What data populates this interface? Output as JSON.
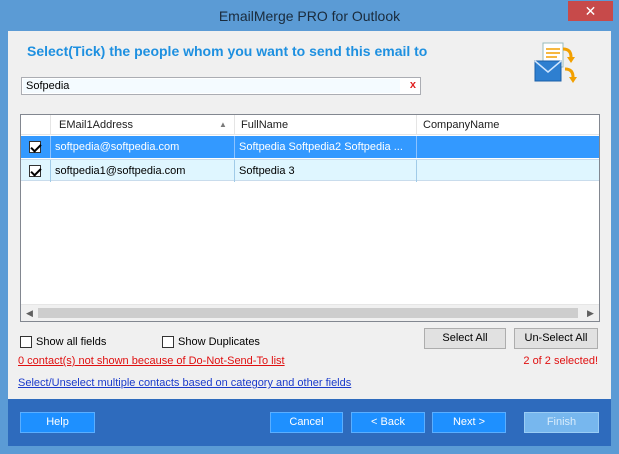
{
  "window": {
    "title": "EmailMerge PRO for Outlook",
    "close_label": "✕"
  },
  "header": {
    "instruction": "Select(Tick) the people whom you want to send this email to"
  },
  "search": {
    "value": "Sofpedia",
    "clear_label": "x"
  },
  "grid": {
    "columns": [
      "EMail1Address",
      "FullName",
      "CompanyName"
    ],
    "rows": [
      {
        "checked": true,
        "email": "softpedia@softpedia.com",
        "fullname": "Softpedia Softpedia2 Softpedia ...",
        "company": ""
      },
      {
        "checked": true,
        "email": "softpedia1@softpedia.com",
        "fullname": "Softpedia 3",
        "company": ""
      }
    ]
  },
  "options": {
    "show_all_fields": "Show all fields",
    "show_duplicates": "Show Duplicates",
    "select_all": "Select All",
    "unselect_all": "Un-Select All"
  },
  "status": {
    "dnst_link": "0 contact(s) not shown because of Do-Not-Send-To list",
    "selected_count": "2 of 2 selected!",
    "category_link": "Select/Unselect multiple contacts based on category and other fields"
  },
  "footer": {
    "help": "Help",
    "cancel": "Cancel",
    "back": "< Back",
    "next": "Next >",
    "finish": "Finish"
  },
  "colors": {
    "accent": "#1e90ff",
    "footer": "#2e6bbd",
    "selected_row": "#3399ff",
    "warning": "#e01010"
  }
}
